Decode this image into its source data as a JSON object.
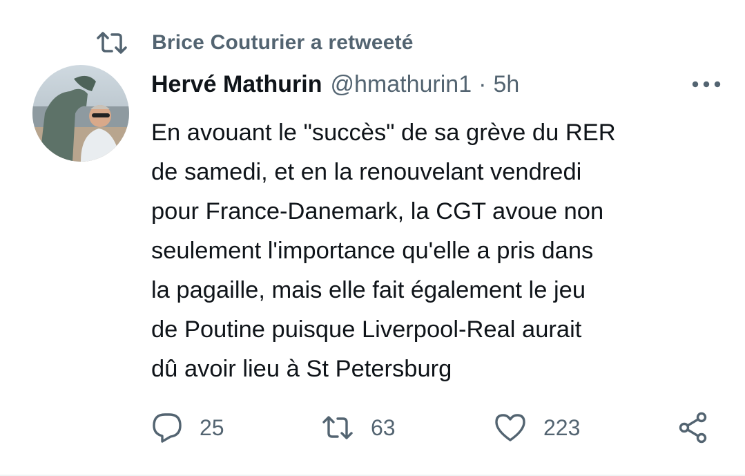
{
  "retweet_context": {
    "icon": "retweet-icon",
    "label": "Brice Couturier a retweeté"
  },
  "tweet": {
    "display_name": "Hervé Mathurin",
    "handle": "@hmathurin1",
    "separator": "·",
    "timestamp": "5h",
    "avatar_icon": "avatar-photo",
    "more_icon": "more-options-icon",
    "text": "En avouant le \"succès\" de sa grève du RER\nde samedi, et en la renouvelant vendredi\npour France-Danemark, la CGT avoue non\nseulement l'importance qu'elle a pris dans\nla pagaille, mais elle fait également le jeu\nde Poutine puisque Liverpool-Real aurait\ndû avoir lieu à St Petersburg"
  },
  "actions": {
    "reply": {
      "icon": "reply-icon",
      "count": "25"
    },
    "retweet": {
      "icon": "retweet-icon",
      "count": "63"
    },
    "like": {
      "icon": "heart-icon",
      "count": "223"
    },
    "share": {
      "icon": "share-icon"
    }
  },
  "colors": {
    "text_primary": "#0f1419",
    "text_secondary": "#536471",
    "divider": "#eff3f4"
  }
}
